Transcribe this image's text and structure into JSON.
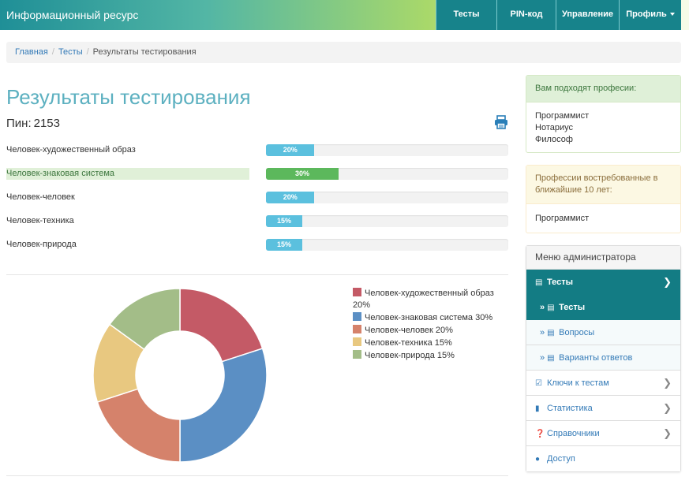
{
  "navbar": {
    "brand": "Информационный ресурс",
    "items": [
      {
        "label": "Тесты"
      },
      {
        "label": "PIN-код"
      },
      {
        "label": "Управление"
      },
      {
        "label": "Профиль"
      }
    ]
  },
  "breadcrumb": {
    "home": "Главная",
    "tests": "Тесты",
    "current": "Результаты тестирования",
    "separator": "/"
  },
  "main": {
    "title": "Результаты тестирования",
    "pin_label": "Пин:",
    "pin_value": "2153",
    "results": [
      {
        "label": "Человек-художественный образ",
        "value": 20,
        "text": "20%"
      },
      {
        "label": "Человек-знаковая система",
        "value": 30,
        "text": "30%"
      },
      {
        "label": "Человек-человек",
        "value": 20,
        "text": "20%"
      },
      {
        "label": "Человек-техника",
        "value": 15,
        "text": "15%"
      },
      {
        "label": "Человек-природа",
        "value": 15,
        "text": "15%"
      }
    ]
  },
  "chart_data": {
    "type": "pie",
    "style": "donut",
    "categories": [
      "Человек-художественный образ",
      "Человек-знаковая система",
      "Человек-человек",
      "Человек-техника",
      "Человек-природа"
    ],
    "values": [
      20,
      30,
      20,
      15,
      15
    ],
    "colors": [
      "#c45a66",
      "#5b8fc4",
      "#d5826b",
      "#e8c880",
      "#a3bd88"
    ],
    "legend": [
      "Человек-художественный образ 20%",
      "Человек-знаковая система 30%",
      "Человек-человек 20%",
      "Человек-техника 15%",
      "Человек-природа 15%"
    ],
    "legend_position": "right"
  },
  "sidebar": {
    "professions_heading": "Вам подходят професии:",
    "professions": [
      "Программист",
      "Нотариус",
      "Философ"
    ],
    "demand_heading": "Профессии востребованные в ближайшие 10 лет:",
    "demand": [
      "Программист"
    ],
    "menu_heading": "Меню администратора",
    "menu": {
      "tests": "Тесты",
      "sub_tests": "Тесты",
      "sub_questions": "Вопросы",
      "sub_answers": "Варианты ответов",
      "keys": "Ключи к тестам",
      "stats": "Статистика",
      "refs": "Справочники",
      "access": "Доступ"
    },
    "raquo": "»"
  },
  "colors": {
    "accent": "#137c84",
    "title": "#5cb0c0",
    "progress_info": "#5bc0de",
    "progress_success": "#5cb85c"
  }
}
